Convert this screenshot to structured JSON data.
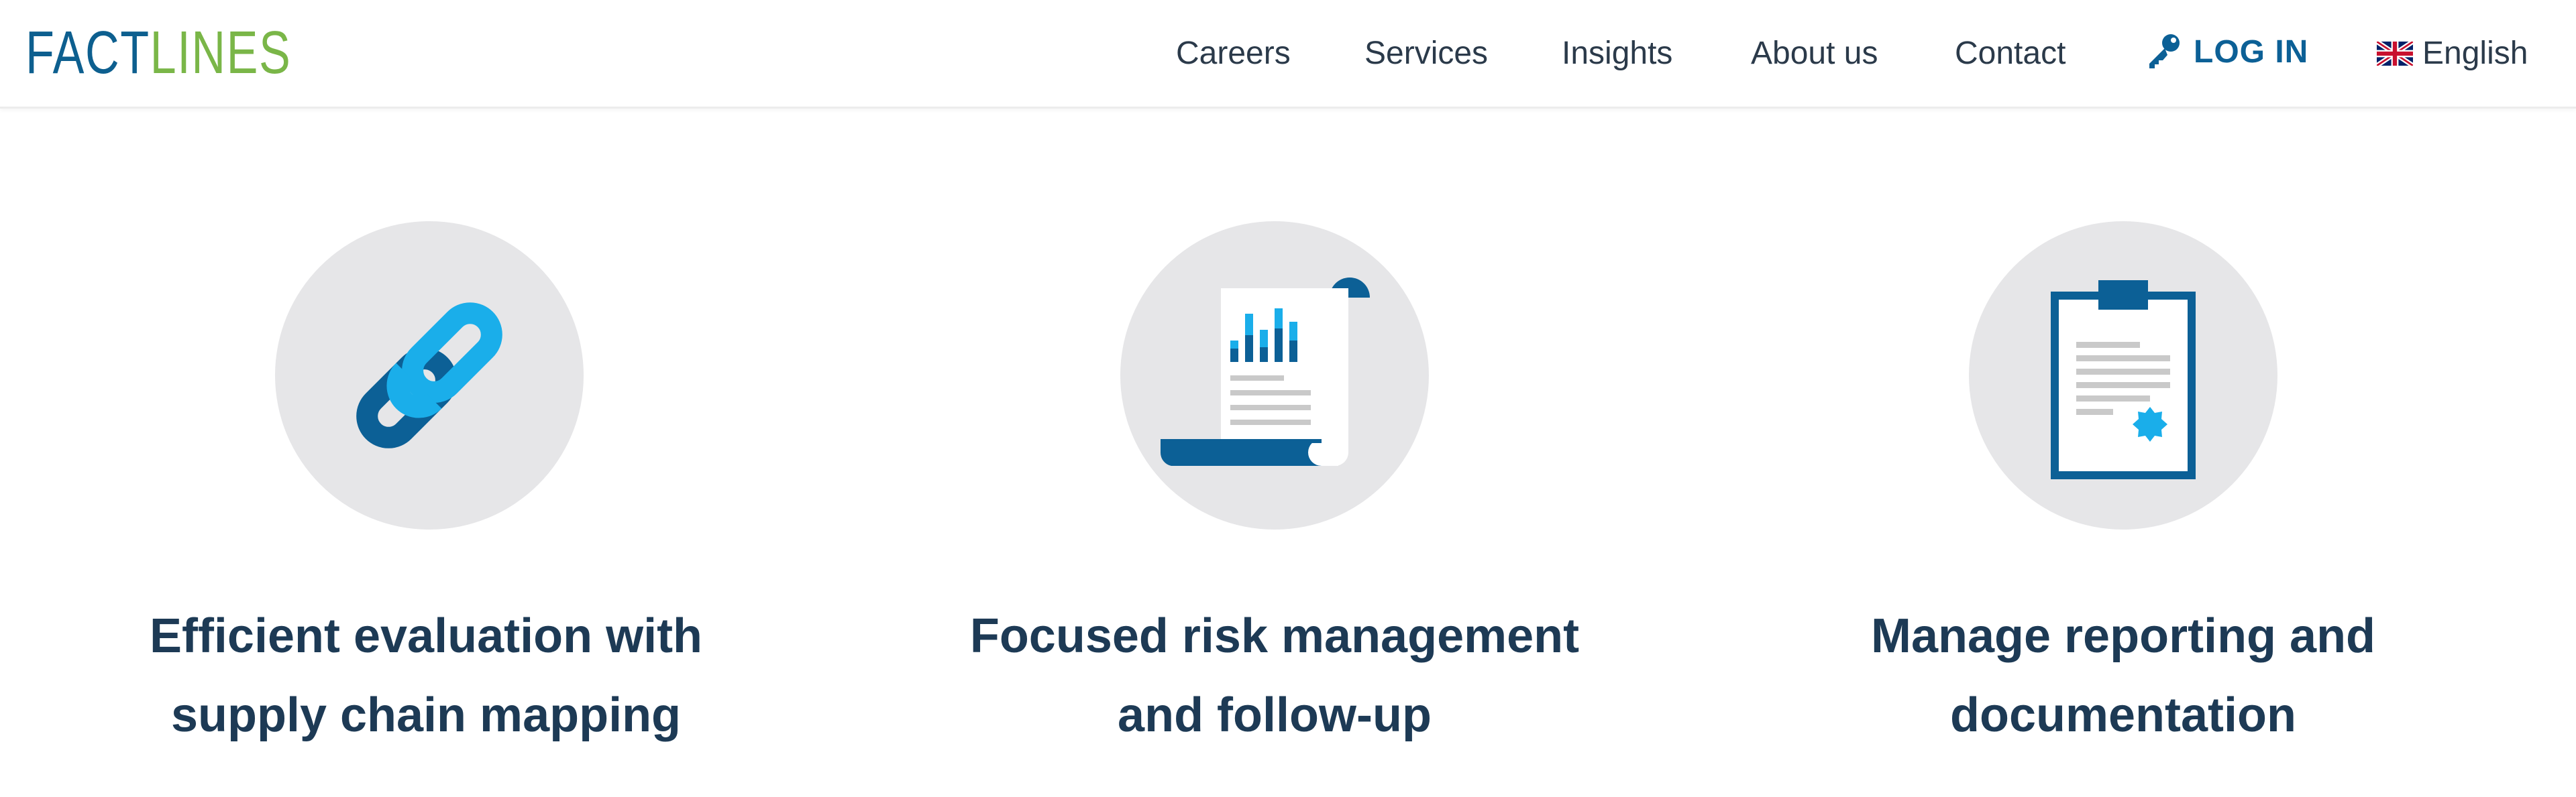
{
  "brand": {
    "logo_part1": "FACT",
    "logo_part2": "LINES",
    "primary_color": "#0d5f8f",
    "secondary_color": "#7ab648"
  },
  "nav": {
    "items": [
      {
        "label": "Careers"
      },
      {
        "label": "Services"
      },
      {
        "label": "Insights"
      },
      {
        "label": "About us"
      },
      {
        "label": "Contact"
      }
    ],
    "login_label": "LOG IN",
    "login_icon": "key-icon",
    "language_label": "English",
    "language_icon": "uk-flag-icon"
  },
  "features": [
    {
      "icon": "chain-link-icon",
      "title_line1": "Efficient evaluation with",
      "title_line2": "supply chain mapping"
    },
    {
      "icon": "report-scroll-icon",
      "title_line1": "Focused risk management",
      "title_line2": "and follow-up"
    },
    {
      "icon": "clipboard-icon",
      "title_line1": "Manage reporting and",
      "title_line2": "documentation"
    }
  ],
  "colors": {
    "accent_dark_blue": "#0c6096",
    "accent_light_blue": "#1aaeea",
    "title_color": "#1d3a55",
    "circle_bg": "#e6e6e8"
  }
}
